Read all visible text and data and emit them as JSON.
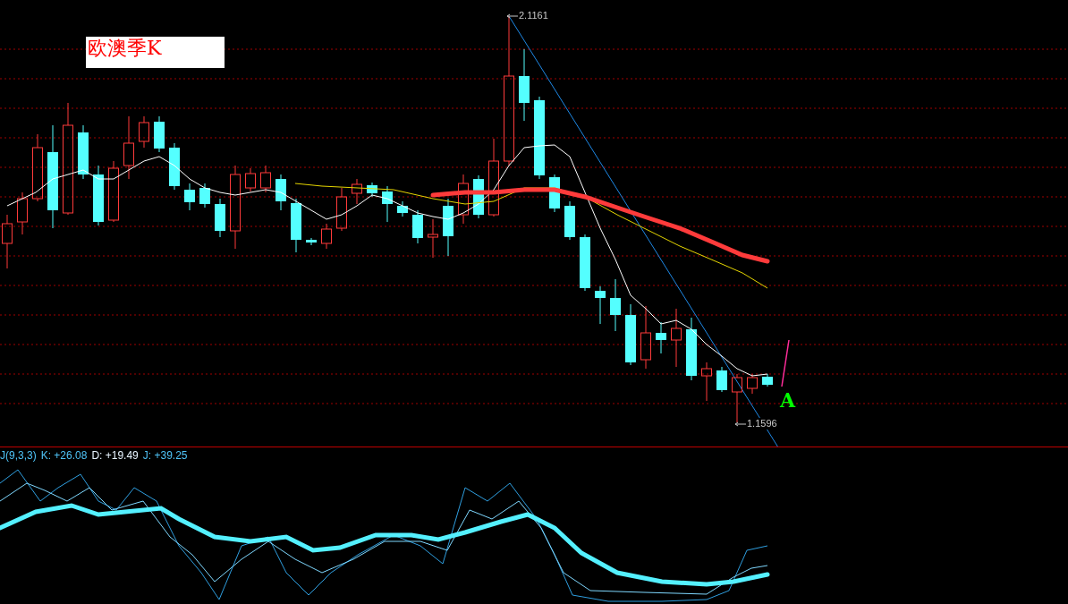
{
  "chart_title": "欧澳季K",
  "high_label": "2.1161",
  "low_label": "1.1596",
  "signal_marker": "A",
  "indicator": {
    "name": "J(9,3,3)",
    "items": [
      {
        "label": "K:",
        "value": "+26.08",
        "color": "#4fc3f7"
      },
      {
        "label": "D:",
        "value": "+19.49",
        "color": "#e8f4ff"
      },
      {
        "label": "J:",
        "value": "+39.25",
        "color": "#4fc3f7"
      }
    ]
  }
}
